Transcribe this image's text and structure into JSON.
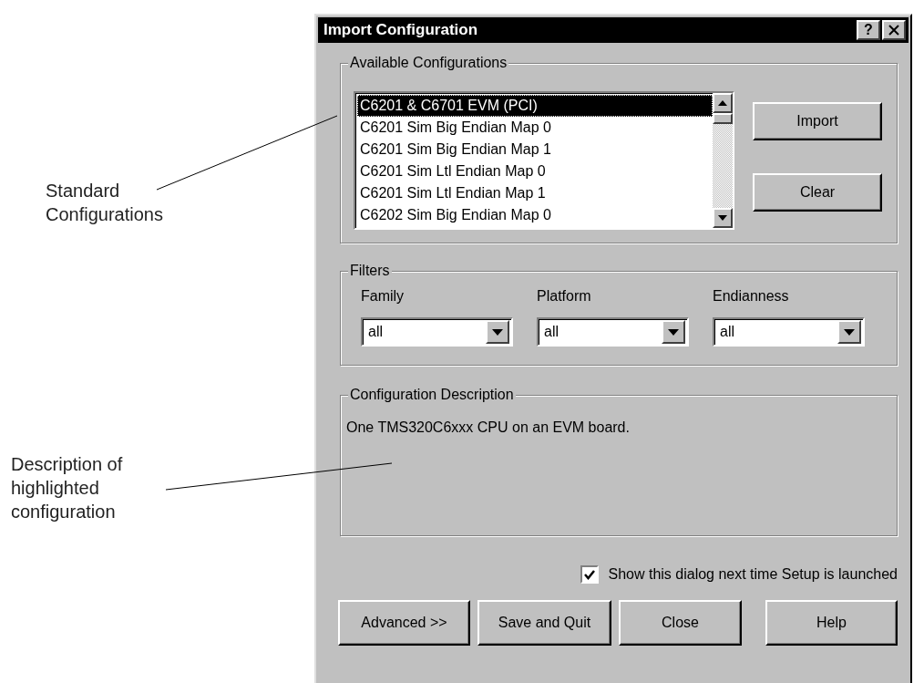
{
  "window": {
    "title": "Import Configuration",
    "help_button": "?"
  },
  "available_configurations": {
    "label": "Available Configurations",
    "items": [
      {
        "label": "C6201 & C6701 EVM (PCI)",
        "selected": true
      },
      {
        "label": "C6201 Sim Big Endian Map 0",
        "selected": false
      },
      {
        "label": "C6201 Sim Big Endian Map 1",
        "selected": false
      },
      {
        "label": "C6201 Sim Ltl Endian Map 0",
        "selected": false
      },
      {
        "label": "C6201 Sim Ltl Endian Map 1",
        "selected": false
      },
      {
        "label": "C6202 Sim Big Endian Map 0",
        "selected": false
      }
    ],
    "buttons": [
      "Import",
      "Clear"
    ]
  },
  "filters": {
    "label": "Filters",
    "fields": [
      {
        "label": "Family",
        "value": "all"
      },
      {
        "label": "Platform",
        "value": "all"
      },
      {
        "label": "Endianness",
        "value": "all"
      }
    ]
  },
  "description": {
    "label": "Configuration Description",
    "text": "One TMS320C6xxx CPU on an EVM board."
  },
  "show_next_time": {
    "label": "Show this dialog next time Setup is launched",
    "checked": true
  },
  "buttons": [
    "Advanced >>",
    "Save and Quit",
    "Close",
    "Help"
  ],
  "annotations": [
    {
      "text": "Standard Configurations"
    },
    {
      "text": "Description of highlighted configuration"
    }
  ]
}
